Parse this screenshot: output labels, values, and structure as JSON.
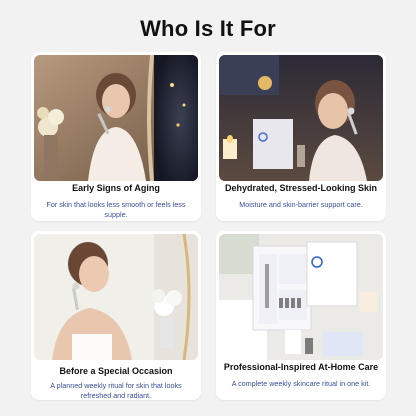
{
  "header": {
    "title": "Who Is It For"
  },
  "cards": [
    {
      "heading": "Early Signs of Aging",
      "description": "For skin that looks less smooth or feels less supple."
    },
    {
      "heading": "Dehydrated, Stressed-Looking Skin",
      "description": "Moisture and skin-barrier support care."
    },
    {
      "heading": "Before a Special Occasion",
      "description": "A planned weekly ritual for skin that looks refreshed and radiant."
    },
    {
      "heading": "Professional-Inspired At-Home Care",
      "description": "A complete weekly skincare ritual in one kit."
    }
  ],
  "colors": {
    "page_bg": "#f2f2f2",
    "card_bg": "#ffffff",
    "heading": "#111111",
    "description": "#3a4f9a"
  }
}
